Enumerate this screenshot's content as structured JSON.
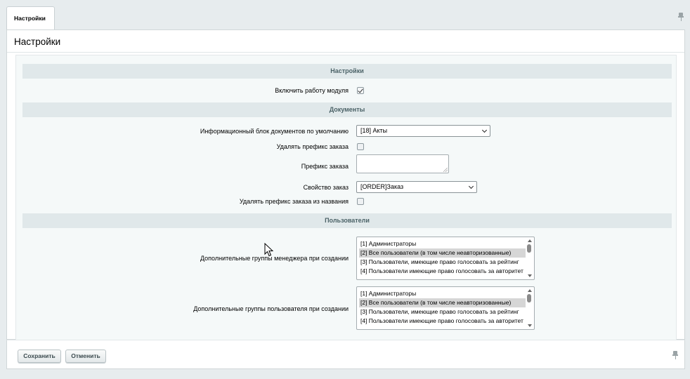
{
  "tabs": [
    {
      "label": "Настройки"
    }
  ],
  "page": {
    "title": "Настройки"
  },
  "sections": {
    "settings": "Настройки",
    "documents": "Документы",
    "users": "Пользователи"
  },
  "fields": {
    "enable_module": {
      "label": "Включить работу модуля",
      "checked": true
    },
    "doc_iblock": {
      "label": "Информационный блок документов по умолчанию",
      "value": "[18] Акты"
    },
    "remove_prefix": {
      "label": "Удалять префикс заказа",
      "checked": false
    },
    "order_prefix": {
      "label": "Префикс заказа",
      "value": ""
    },
    "order_property": {
      "label": "Свойство заказ",
      "value": "[ORDER]Заказ"
    },
    "remove_prefix_name": {
      "label": "Удалять префикс заказа из названия",
      "checked": false
    },
    "manager_groups": {
      "label": "Дополнительные группы менеджера при создании",
      "options": [
        {
          "label": "[1] Администраторы",
          "selected": false
        },
        {
          "label": "[2] Все пользователи (в том числе неавторизованные)",
          "selected": true
        },
        {
          "label": "[3] Пользователи, имеющие право голосовать за рейтинг",
          "selected": false
        },
        {
          "label": "[4] Пользователи имеющие право голосовать за авторитет",
          "selected": false
        }
      ]
    },
    "user_groups": {
      "label": "Дополнительные группы пользователя при создании",
      "options": [
        {
          "label": "[1] Администраторы",
          "selected": false
        },
        {
          "label": "[2] Все пользователи (в том числе неавторизованные)",
          "selected": true
        },
        {
          "label": "[3] Пользователи, имеющие право голосовать за рейтинг",
          "selected": false
        },
        {
          "label": "[4] Пользователи имеющие право голосовать за авторитет",
          "selected": false
        }
      ]
    }
  },
  "footer": {
    "save_label": "Сохранить",
    "cancel_label": "Отменить"
  },
  "icons": {
    "pin": "pin-icon",
    "cursor": "mouse-cursor-icon",
    "dropdown": "chevron-down-icon"
  }
}
